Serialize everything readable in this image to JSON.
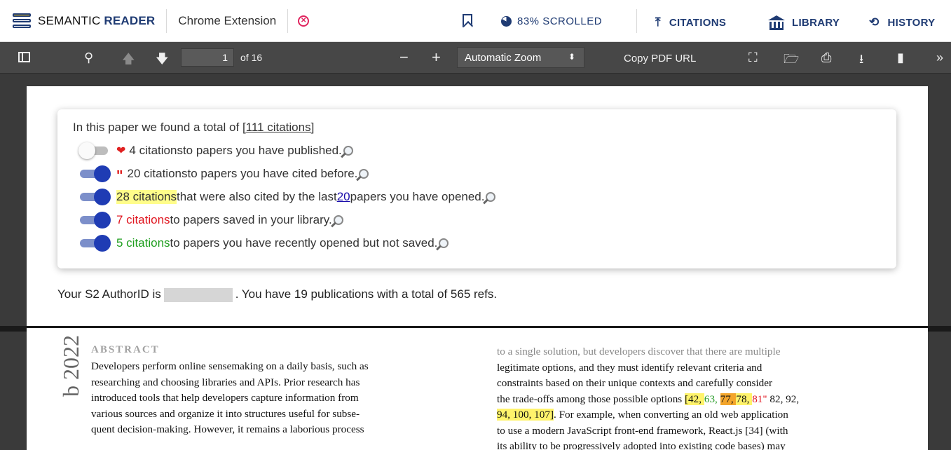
{
  "topbar": {
    "brand_plain": "SEMANTIC ",
    "brand_bold": "READER",
    "extension_label": "Chrome Extension",
    "scrolled_label": "83% SCROLLED",
    "scrolled_percent": 83,
    "citations_label": "CITATIONS",
    "library_label": "LIBRARY",
    "history_label": "HISTORY"
  },
  "pdf_toolbar": {
    "page_number": "1",
    "page_of": "of 16",
    "zoom": "Automatic Zoom",
    "copy_url": "Copy PDF URL"
  },
  "card": {
    "intro_prefix": "In this paper we found a total of ",
    "intro_link": "[111 citations]",
    "rows": [
      {
        "toggle": "off",
        "count": "4 citations",
        "text": " to papers you have published."
      },
      {
        "toggle": "on",
        "count": "20 citations",
        "text": " to papers you have cited before."
      },
      {
        "toggle": "on",
        "count": "28 citations",
        "text_a": " that were also cited by the last ",
        "link": "20",
        "text_b": " papers you have opened."
      },
      {
        "toggle": "on",
        "count": "7 citations",
        "text": " to papers saved in your library."
      },
      {
        "toggle": "on",
        "count": "5 citations",
        "text": " to papers you have recently opened but not saved."
      }
    ]
  },
  "author": {
    "prefix": "Your S2 AuthorID is",
    "suffix": ". You have 19 publications with a total of 565 refs."
  },
  "paper": {
    "year_margin": "b 2022",
    "abstract_heading": "ABSTRACT",
    "left_lines": [
      "Developers perform online sensemaking on a daily basis, such as",
      "researching and choosing libraries and APIs. Prior research has",
      "introduced tools that help developers capture information from",
      "various sources and organize it into structures useful for subse-",
      "quent decision-making. However, it remains a laborious process"
    ],
    "right_line_0": "to a single solution, but developers discover that there are multiple",
    "right_line_1": "legitimate options, and they must identify relevant criteria and",
    "right_line_2": "constraints based on their unique contexts and carefully consider",
    "right_line_3_prefix": "the trade-offs among those possible options ",
    "cite_open": "[42, ",
    "cite_63": "63, ",
    "cite_77": "77, ",
    "cite_78": "78, ",
    "cite_81": "81",
    "cite_rest": " 82, 92,",
    "cite_line2": "94, 100, 107]",
    "right_line_4_suffix": ". For example, when converting an old web application",
    "right_line_5": "to use a modern JavaScript front-end framework, React.js [34] (with",
    "right_line_6": "its ability to be progressively adopted into existing code bases) may"
  }
}
